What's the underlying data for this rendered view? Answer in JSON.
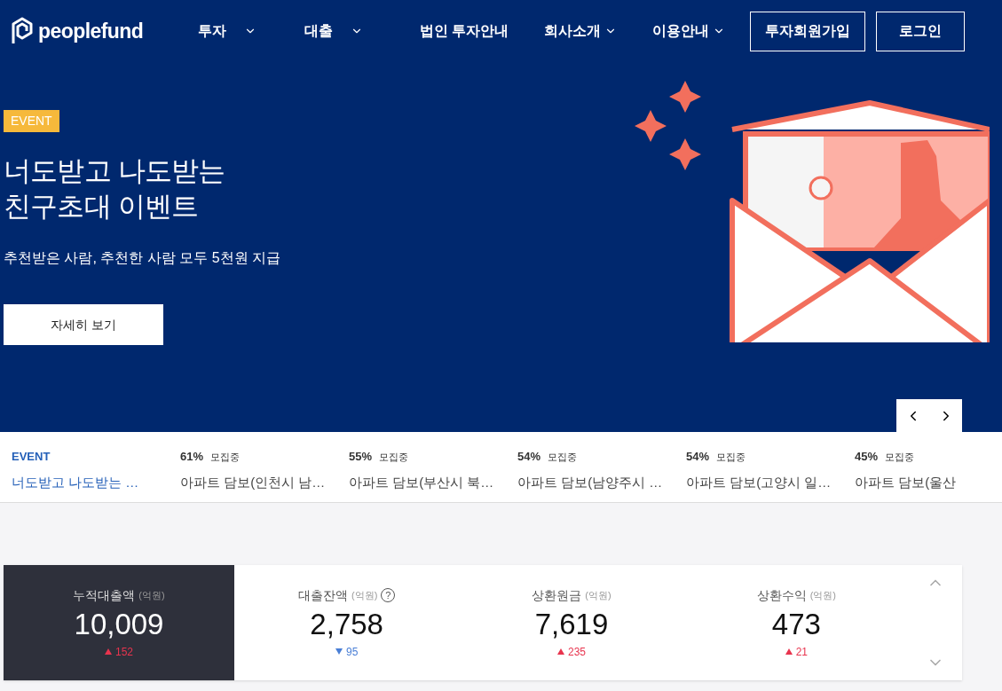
{
  "header": {
    "logo": "peoplefund",
    "nav_left": [
      {
        "label": "투자",
        "dropdown": true
      },
      {
        "label": "대출",
        "dropdown": true
      }
    ],
    "nav_right": [
      {
        "label": "법인 투자안내",
        "dropdown": false
      },
      {
        "label": "회사소개",
        "dropdown": true
      },
      {
        "label": "이용안내",
        "dropdown": true
      }
    ],
    "buttons": [
      "투자회원가입",
      "로그인"
    ]
  },
  "hero": {
    "badge": "EVENT",
    "title_lines": [
      "너도받고 나도받는",
      "친구초대 이벤트"
    ],
    "subtitle": "추천받은 사람, 추천한 사람 모두 5천원 지급",
    "cta": "자세히 보기"
  },
  "ticker": [
    {
      "kind": "event",
      "tag": "EVENT",
      "title": "너도받고 나도받는 …"
    },
    {
      "kind": "loan",
      "percent": "61%",
      "status": "모집중",
      "title": "아파트 담보(인천시 남…"
    },
    {
      "kind": "loan",
      "percent": "55%",
      "status": "모집중",
      "title": "아파트 담보(부산시 북…"
    },
    {
      "kind": "loan",
      "percent": "54%",
      "status": "모집중",
      "title": "아파트 담보(남양주시 …"
    },
    {
      "kind": "loan",
      "percent": "54%",
      "status": "모집중",
      "title": "아파트 담보(고양시 일…"
    },
    {
      "kind": "loan",
      "percent": "45%",
      "status": "모집중",
      "title": "아파트 담보(울산"
    }
  ],
  "stats": [
    {
      "label": "누적대출액",
      "unit": "(억원)",
      "help": false,
      "value": "10,009",
      "change": "152",
      "kind": "rise",
      "selected": true
    },
    {
      "label": "대출잔액",
      "unit": "(억원)",
      "help": true,
      "help_text": "?",
      "value": "2,758",
      "change": "95",
      "kind": "fall",
      "selected": false
    },
    {
      "label": "상환원금",
      "unit": "(억원)",
      "help": false,
      "value": "7,619",
      "change": "235",
      "kind": "rise",
      "selected": false
    },
    {
      "label": "상환수익",
      "unit": "(억원)",
      "help": false,
      "value": "473",
      "change": "21",
      "kind": "rise",
      "selected": false
    }
  ]
}
